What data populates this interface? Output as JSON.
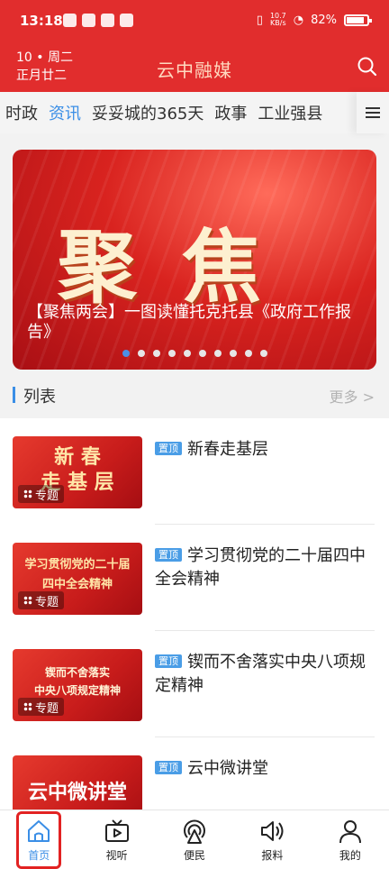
{
  "status_bar": {
    "time": "13:18",
    "net_speed_top": "10.7",
    "net_speed_bottom": "KB/s",
    "battery": "82%"
  },
  "header": {
    "date_line1": "10 • 周二",
    "date_line2": "正月廿二",
    "title": "云中融媒"
  },
  "tabs": [
    {
      "label": "时政",
      "active": false
    },
    {
      "label": "资讯",
      "active": true
    },
    {
      "label": "妥妥城的365天",
      "active": false
    },
    {
      "label": "政事",
      "active": false
    },
    {
      "label": "工业强县",
      "active": false
    }
  ],
  "banner": {
    "big_text": "聚焦",
    "caption": "【聚焦两会】一图读懂托克托县《政府工作报告》",
    "dot_count": 10,
    "active_dot": 0
  },
  "list_header": {
    "label": "列表",
    "more": "更多 >"
  },
  "list": [
    {
      "thumb_text": "新 春\n走 基 层",
      "tag": "专题",
      "pin": "置顶",
      "title": "新春走基层"
    },
    {
      "thumb_text": "学习贯彻党的二十届\n四中全会精神",
      "tag": "专题",
      "pin": "置顶",
      "title": "学习贯彻党的二十届四中全会精神"
    },
    {
      "thumb_text": "锲而不舍落实\n中央八项规定精神",
      "tag": "专题",
      "pin": "置顶",
      "title": "锲而不舍落实中央八项规定精神"
    },
    {
      "thumb_text": "云中微讲堂",
      "tag": "",
      "pin": "置顶",
      "title": "云中微讲堂"
    }
  ],
  "bottom_nav": [
    {
      "label": "首页",
      "icon": "home-icon",
      "active": true
    },
    {
      "label": "视听",
      "icon": "video-icon",
      "active": false
    },
    {
      "label": "便民",
      "icon": "service-icon",
      "active": false
    },
    {
      "label": "报料",
      "icon": "speaker-icon",
      "active": false
    },
    {
      "label": "我的",
      "icon": "user-icon",
      "active": false
    }
  ],
  "colors": {
    "brand_red": "#e12d2d",
    "accent_blue": "#3a8ee6"
  }
}
